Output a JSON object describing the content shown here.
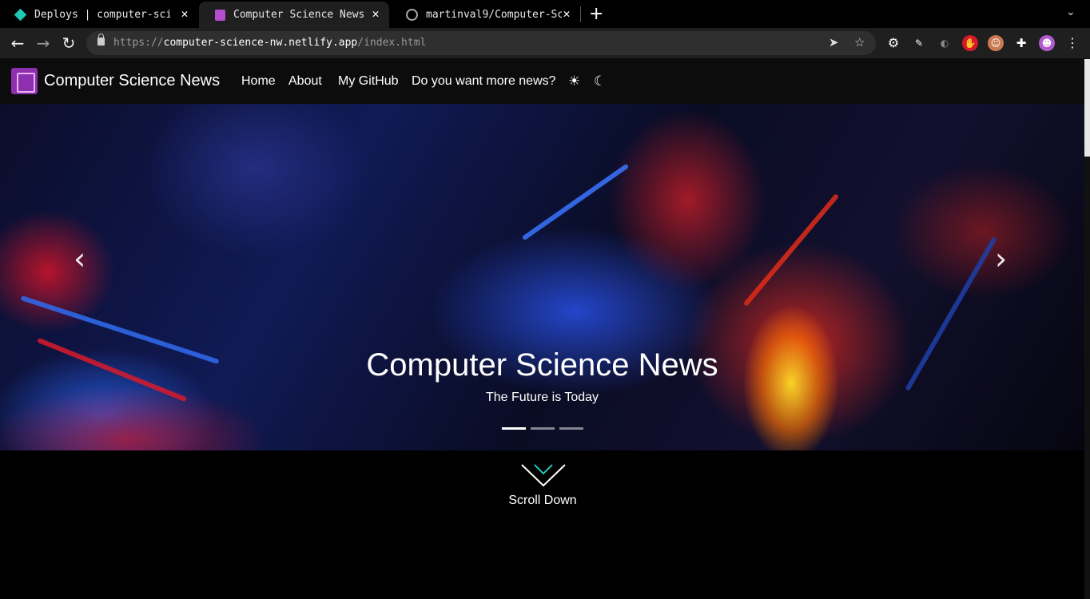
{
  "browser": {
    "tabs": [
      {
        "title": "Deploys | computer-sci",
        "favicon": "netlify-diamond-icon",
        "active": false
      },
      {
        "title": "Computer Science News",
        "favicon": "book-icon",
        "active": true
      },
      {
        "title": "martinval9/Computer-Sc",
        "favicon": "github-icon",
        "active": false
      }
    ],
    "url": {
      "scheme": "https://",
      "host": "computer-science-nw.netlify.app",
      "path": "/index.html"
    },
    "colors": {
      "tabstrip": "#000000",
      "toolbar": "#1f1f1f",
      "omnibox": "#2f2f2f"
    }
  },
  "site": {
    "brand": "Computer Science News",
    "nav": {
      "home": "Home",
      "about": "About",
      "github": "My GitHub",
      "more": "Do you want more news?"
    },
    "hero": {
      "title": "Computer Science News",
      "subtitle": "The Future is Today",
      "slide_count": 3,
      "active_slide": 1
    },
    "scroll_down": "Scroll Down",
    "colors": {
      "navbar": "#0c0c0c",
      "accent": "#1fc7b5",
      "background": "#000000"
    }
  }
}
